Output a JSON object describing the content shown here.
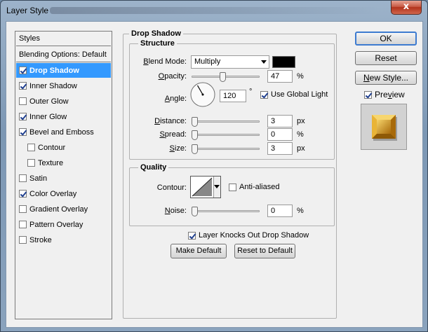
{
  "window": {
    "title": "Layer Style",
    "close_glyph": "x"
  },
  "styles_list": {
    "header": "Styles",
    "items": [
      {
        "label": "Blending Options: Default",
        "has_checkbox": false,
        "checked": false,
        "selected": false,
        "indent": false
      },
      {
        "label": "Drop Shadow",
        "has_checkbox": true,
        "checked": true,
        "selected": true,
        "indent": false
      },
      {
        "label": "Inner Shadow",
        "has_checkbox": true,
        "checked": true,
        "selected": false,
        "indent": false
      },
      {
        "label": "Outer Glow",
        "has_checkbox": true,
        "checked": false,
        "selected": false,
        "indent": false
      },
      {
        "label": "Inner Glow",
        "has_checkbox": true,
        "checked": true,
        "selected": false,
        "indent": false
      },
      {
        "label": "Bevel and Emboss",
        "has_checkbox": true,
        "checked": true,
        "selected": false,
        "indent": false
      },
      {
        "label": "Contour",
        "has_checkbox": true,
        "checked": false,
        "selected": false,
        "indent": true
      },
      {
        "label": "Texture",
        "has_checkbox": true,
        "checked": false,
        "selected": false,
        "indent": true
      },
      {
        "label": "Satin",
        "has_checkbox": true,
        "checked": false,
        "selected": false,
        "indent": false
      },
      {
        "label": "Color Overlay",
        "has_checkbox": true,
        "checked": true,
        "selected": false,
        "indent": false
      },
      {
        "label": "Gradient Overlay",
        "has_checkbox": true,
        "checked": false,
        "selected": false,
        "indent": false
      },
      {
        "label": "Pattern Overlay",
        "has_checkbox": true,
        "checked": false,
        "selected": false,
        "indent": false
      },
      {
        "label": "Stroke",
        "has_checkbox": true,
        "checked": false,
        "selected": false,
        "indent": false
      }
    ]
  },
  "drop_shadow": {
    "title": "Drop Shadow",
    "structure": {
      "title": "Structure",
      "blend_mode_label": "Blend Mode:",
      "blend_mode_value": "Multiply",
      "shadow_color": "#000000",
      "opacity_label": "Opacity:",
      "opacity_value": "47",
      "opacity_unit": "%",
      "opacity_fraction": 0.47,
      "angle_label": "Angle:",
      "angle_value": "120",
      "angle_degrees": 120,
      "angle_unit": "°",
      "use_global_light_label": "Use Global Light",
      "use_global_light_checked": true,
      "distance_label": "Distance:",
      "distance_value": "3",
      "distance_unit": "px",
      "distance_fraction": 0.0,
      "spread_label": "Spread:",
      "spread_value": "0",
      "spread_unit": "%",
      "spread_fraction": 0.0,
      "size_label": "Size:",
      "size_value": "3",
      "size_unit": "px",
      "size_fraction": 0.0
    },
    "quality": {
      "title": "Quality",
      "contour_label": "Contour:",
      "anti_aliased_label": "Anti-aliased",
      "anti_aliased_checked": false,
      "noise_label": "Noise:",
      "noise_value": "0",
      "noise_unit": "%",
      "noise_fraction": 0.0
    },
    "knockout_label": "Layer Knocks Out Drop Shadow",
    "knockout_checked": true,
    "make_default_label": "Make Default",
    "reset_default_label": "Reset to Default"
  },
  "buttons": {
    "ok": "OK",
    "reset": "Reset",
    "new_style": "New Style...",
    "preview_label": "Preview",
    "preview_checked": true
  },
  "colors": {
    "selection": "#3399ff",
    "preview_gold": "#d89a1a"
  }
}
